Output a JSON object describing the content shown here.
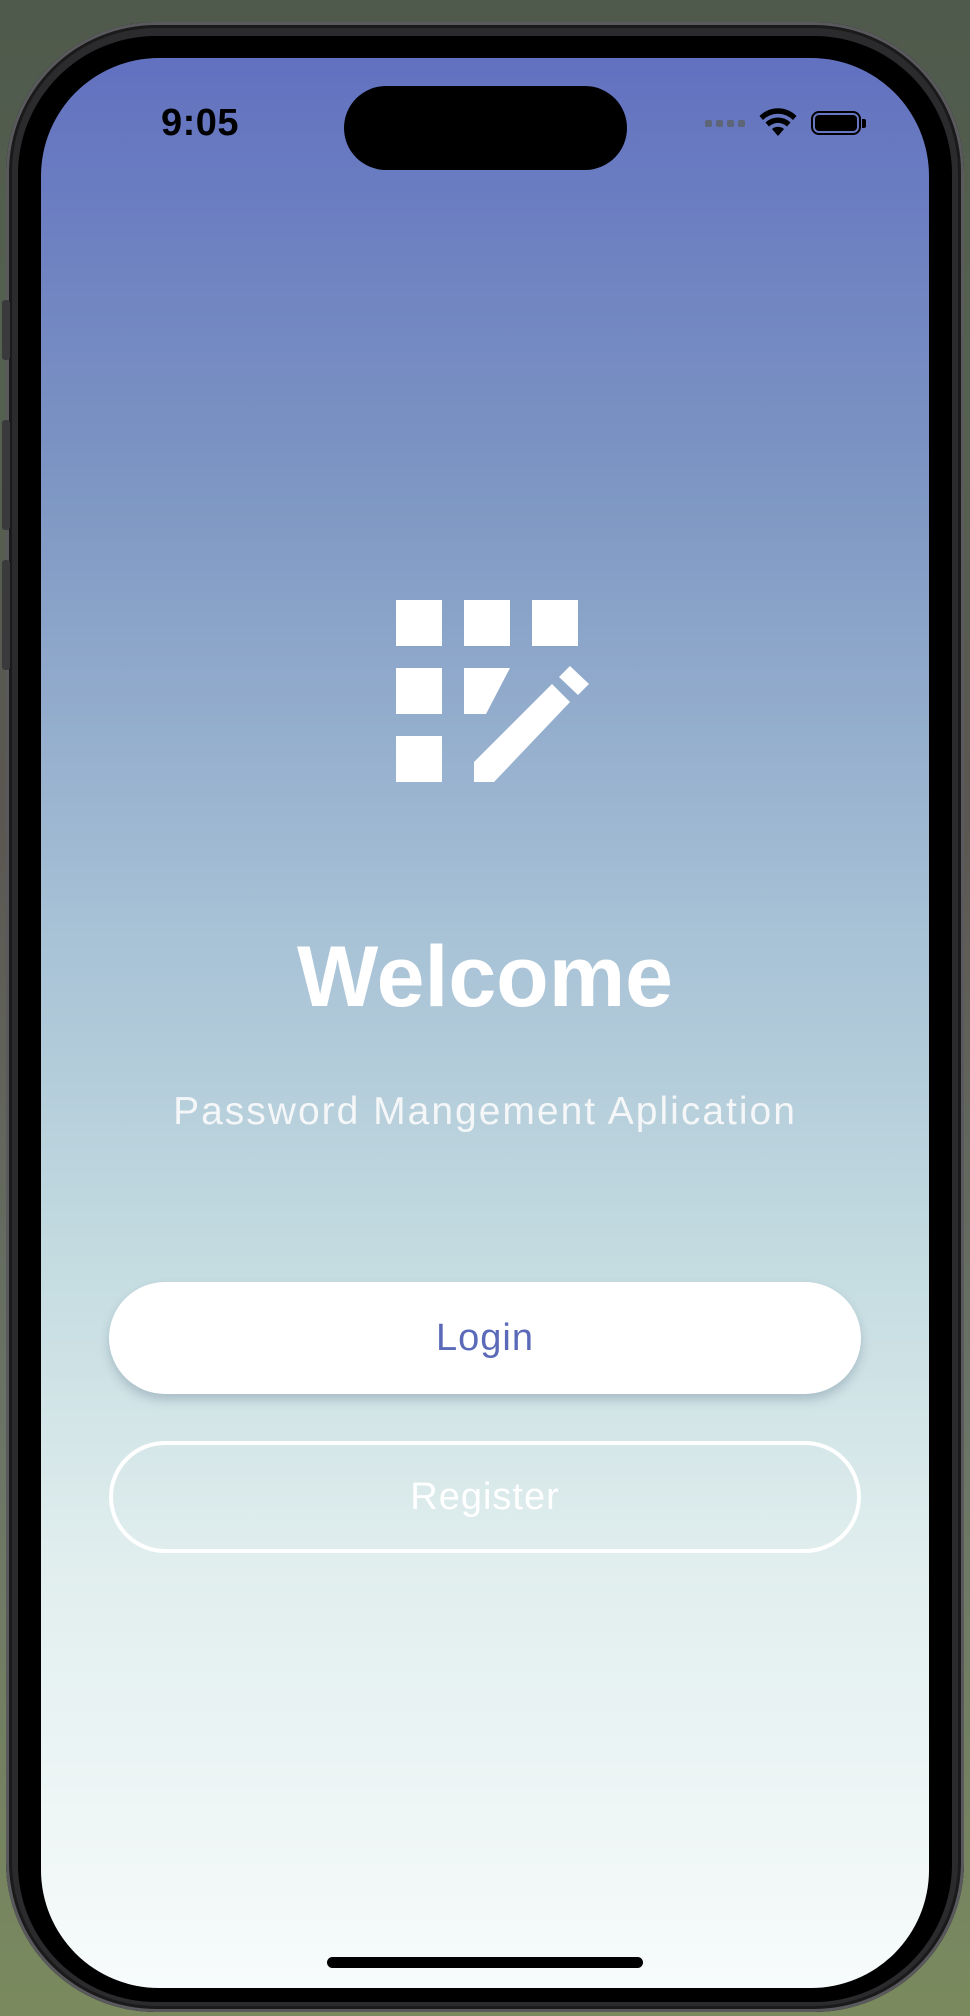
{
  "status_bar": {
    "time": "9:05",
    "icons": [
      "cellular-signal-icon",
      "wifi-icon",
      "battery-icon"
    ]
  },
  "app": {
    "logo_icon": "grid-pencil-icon",
    "title": "Welcome",
    "subtitle": "Password Mangement Aplication",
    "login_label": "Login",
    "register_label": "Register"
  },
  "colors": {
    "gradient_top": "#6271c0",
    "gradient_bottom": "#f7fbfb",
    "accent": "#5b6ab8",
    "button_bg": "#ffffff"
  }
}
